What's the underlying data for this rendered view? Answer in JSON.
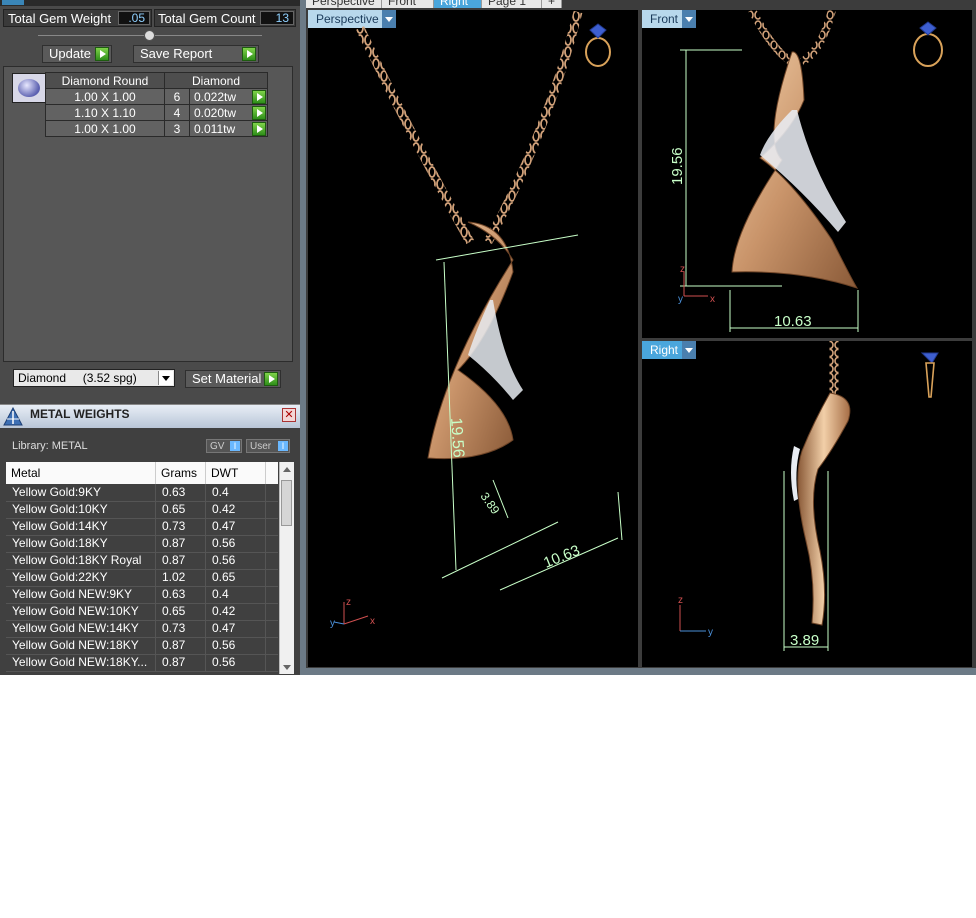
{
  "top_tabs": [
    "Perspective",
    "Front",
    "Right",
    "Page 1",
    "+"
  ],
  "gem_summary": {
    "weight_label": "Total Gem Weight",
    "weight_value": ".05",
    "count_label": "Total Gem Count",
    "count_value": "13"
  },
  "buttons": {
    "update": "Update",
    "save_report": "Save Report",
    "set_material": "Set Material"
  },
  "gem_table": {
    "headers": [
      "Diamond Round",
      "Diamond"
    ],
    "rows": [
      {
        "size": "1.00 X 1.00",
        "count": "6",
        "weight": "0.022tw"
      },
      {
        "size": "1.10 X 1.10",
        "count": "4",
        "weight": "0.020tw"
      },
      {
        "size": "1.00 X 1.00",
        "count": "3",
        "weight": "0.011tw"
      }
    ]
  },
  "material_select": "Diamond     (3.52 spg)",
  "metal_weights": {
    "title": "METAL WEIGHTS",
    "close": "✕",
    "library": "Library: METAL",
    "gv": "GV",
    "user": "User",
    "toggle_i": "I",
    "headers": {
      "metal": "Metal",
      "grams": "Grams",
      "dwt": "DWT"
    },
    "rows": [
      {
        "metal": "Yellow Gold:9KY",
        "grams": "0.63",
        "dwt": "0.4"
      },
      {
        "metal": "Yellow Gold:10KY",
        "grams": "0.65",
        "dwt": "0.42"
      },
      {
        "metal": "Yellow Gold:14KY",
        "grams": "0.73",
        "dwt": "0.47"
      },
      {
        "metal": "Yellow Gold:18KY",
        "grams": "0.87",
        "dwt": "0.56"
      },
      {
        "metal": "Yellow Gold:18KY Royal",
        "grams": "0.87",
        "dwt": "0.56"
      },
      {
        "metal": "Yellow Gold:22KY",
        "grams": "1.02",
        "dwt": "0.65"
      },
      {
        "metal": "Yellow Gold NEW:9KY",
        "grams": "0.63",
        "dwt": "0.4"
      },
      {
        "metal": "Yellow Gold NEW:10KY",
        "grams": "0.65",
        "dwt": "0.42"
      },
      {
        "metal": "Yellow Gold NEW:14KY",
        "grams": "0.73",
        "dwt": "0.47"
      },
      {
        "metal": "Yellow Gold NEW:18KY",
        "grams": "0.87",
        "dwt": "0.56"
      },
      {
        "metal": "Yellow Gold NEW:18KY...",
        "grams": "0.87",
        "dwt": "0.56"
      }
    ]
  },
  "viewports": {
    "perspective": {
      "label": "Perspective",
      "dim_height": "19.56",
      "dim_width": "10.63",
      "dim_depth": "3.89"
    },
    "front": {
      "label": "Front",
      "dim_height": "19.56",
      "dim_width": "10.63"
    },
    "right": {
      "label": "Right",
      "dim_depth": "3.89"
    }
  },
  "axes": {
    "x": "x",
    "y": "y",
    "z": "z"
  },
  "colors": {
    "gold": "#d9a77a",
    "dim_line": "#c8ffc8",
    "panel": "#4a4a4a",
    "viewport_bg": "#000000"
  }
}
